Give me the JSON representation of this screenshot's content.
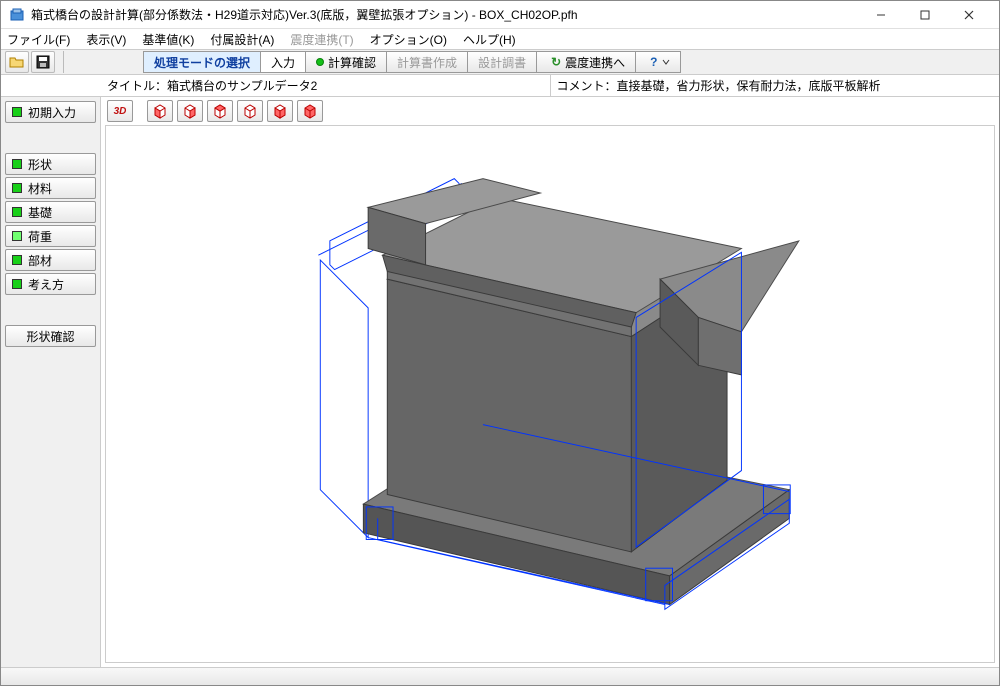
{
  "window": {
    "title": "箱式橋台の設計計算(部分係数法・H29道示対応)Ver.3(底版，翼壁拡張オプション) - BOX_CH02OP.pfh"
  },
  "menu": {
    "file": "ファイル(F)",
    "view": "表示(V)",
    "standard": "基準値(K)",
    "attach": "付属設計(A)",
    "seismic": "震度連携(T)",
    "options": "オプション(O)",
    "help": "ヘルプ(H)"
  },
  "tabs": {
    "mode": "処理モードの選択",
    "input": "入力",
    "check": "計算確認",
    "report": "計算書作成",
    "adjust": "設計調書",
    "seismic_link": "震度連携へ"
  },
  "info": {
    "title_label": "タイトル：",
    "title_value": "箱式橋台のサンプルデータ2",
    "comment_label": "コメント：",
    "comment_value": "直接基礎，省力形状，保有耐力法，底版平板解析"
  },
  "sidebar": {
    "initial": "初期入力",
    "shape": "形状",
    "material": "材料",
    "foundation": "基礎",
    "load": "荷重",
    "member": "部材",
    "concept": "考え方",
    "shape_confirm": "形状確認"
  },
  "viewbar": {
    "threeD": "3D"
  }
}
